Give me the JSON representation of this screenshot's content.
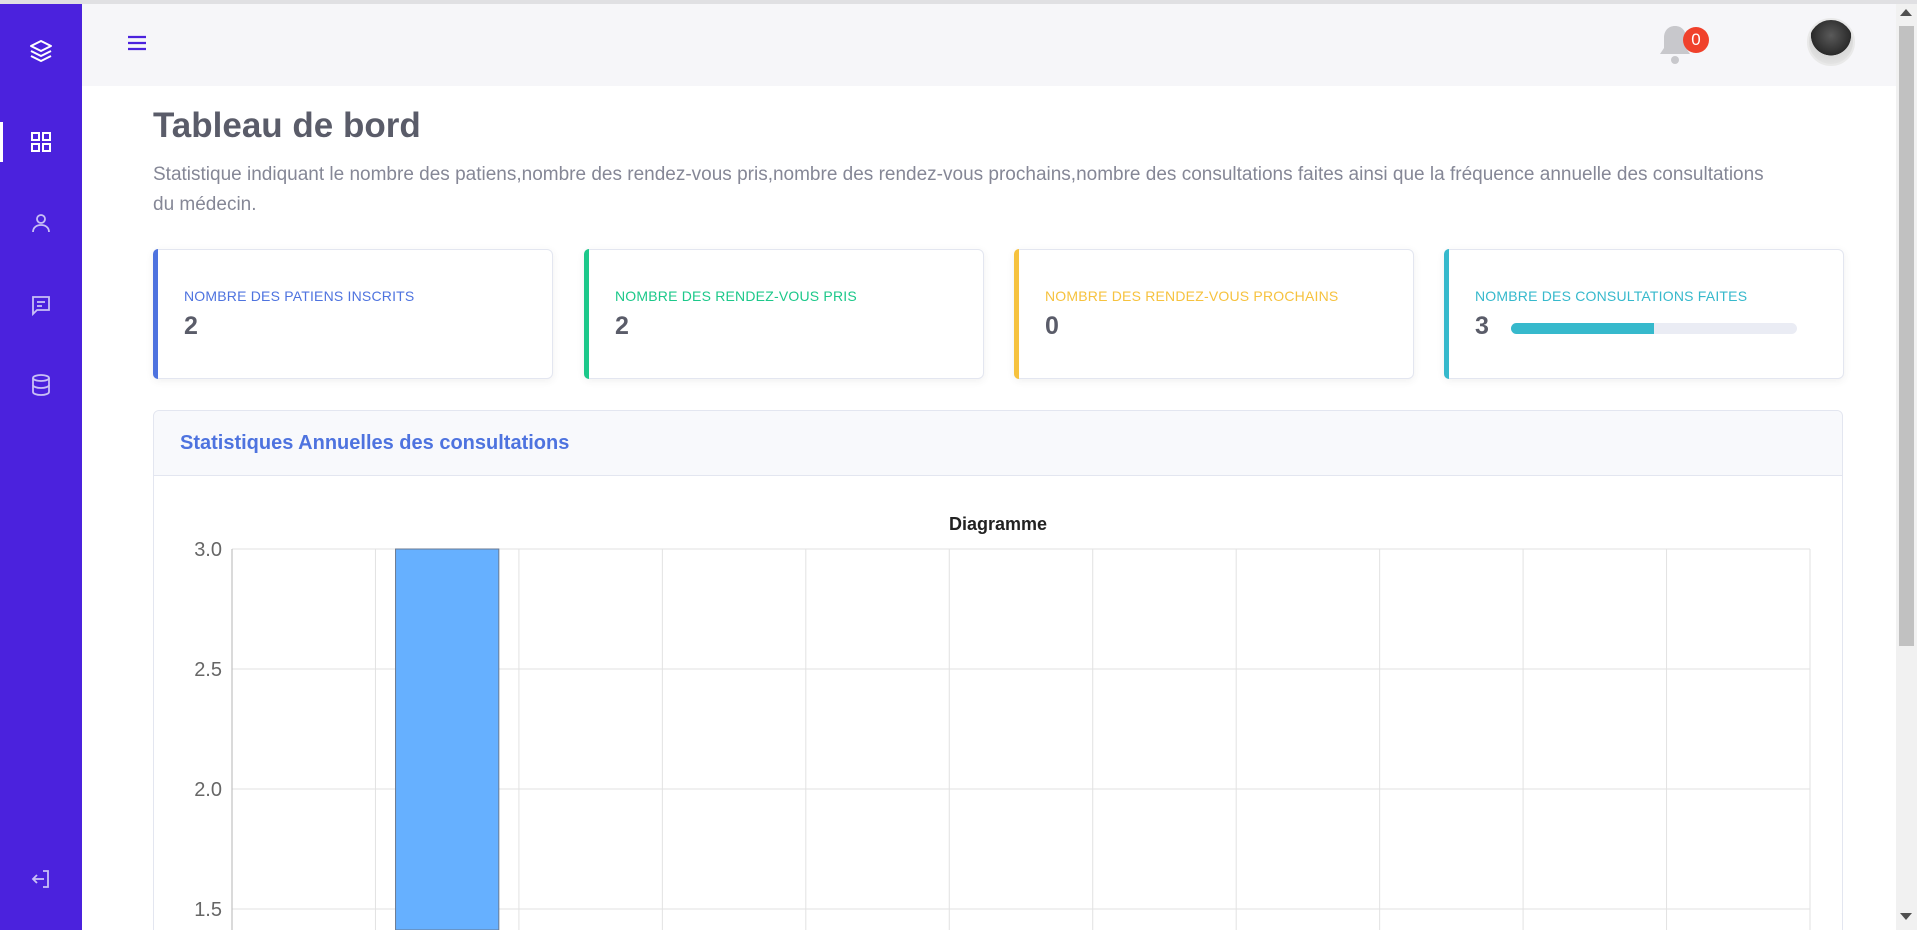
{
  "sidebar": {
    "items": [
      {
        "icon": "layers-icon"
      },
      {
        "icon": "grid-icon"
      },
      {
        "icon": "user-icon"
      },
      {
        "icon": "message-icon"
      },
      {
        "icon": "database-icon"
      },
      {
        "icon": "logout-icon"
      }
    ]
  },
  "topbar": {
    "notification_count": "0"
  },
  "page": {
    "title": "Tableau de bord",
    "description": "Statistique indiquant le nombre des patiens,nombre des rendez-vous pris,nombre des rendez-vous prochains,nombre des consultations faites ainsi que la fréquence annuelle des consultations du médecin."
  },
  "cards": [
    {
      "label": "Nombre des patiens inscrits",
      "value": "2",
      "color": "#4e73df"
    },
    {
      "label": "Nombre des rendez-vous pris",
      "value": "2",
      "color": "#1cc88a"
    },
    {
      "label": "Nombre des rendez-vous prochains",
      "value": "0",
      "color": "#f6c23e"
    },
    {
      "label": "Nombre des consultations faites",
      "value": "3",
      "color": "#36b9cc",
      "progress": 0.5
    }
  ],
  "chart_section": {
    "title": "Statistiques Annuelles des consultations"
  },
  "chart_data": {
    "type": "bar",
    "title": "Diagramme",
    "categories": [
      "",
      "",
      "",
      "",
      "",
      "",
      "",
      "",
      "",
      "",
      ""
    ],
    "values": [
      0,
      3,
      0,
      0,
      0,
      0,
      0,
      0,
      0,
      0,
      0
    ],
    "y_ticks": [
      "3.0",
      "2.5",
      "2.0",
      "1.5"
    ],
    "ylim_visible": [
      1.5,
      3.0
    ],
    "bar_color": "#66b0ff",
    "grid": true
  }
}
